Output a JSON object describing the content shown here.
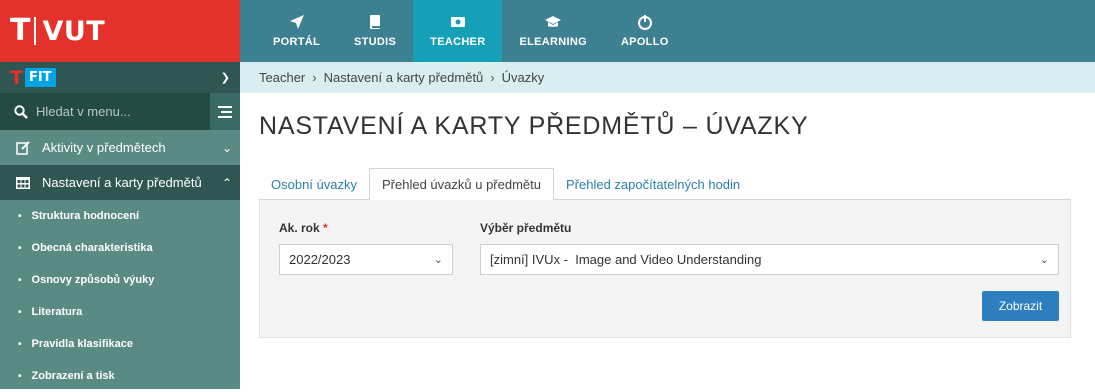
{
  "brand": {
    "logo_letter": "T",
    "logo_text": "VUT",
    "accent": "#e4312b",
    "nav_bg": "#3c8091",
    "nav_active": "#16a0b8"
  },
  "topnav": [
    {
      "label": "PORTÁL",
      "icon": "send-icon"
    },
    {
      "label": "STUDIS",
      "icon": "book-icon"
    },
    {
      "label": "TEACHER",
      "icon": "teacher-icon",
      "active": true
    },
    {
      "label": "ELEARNING",
      "icon": "graduation-cap-icon"
    },
    {
      "label": "APOLLO",
      "icon": "apollo-icon"
    }
  ],
  "sidebar": {
    "faculty_letter": "T",
    "faculty": "FIT",
    "search_placeholder": "Hledat v menu...",
    "items": [
      {
        "label": "Aktivity v předmětech",
        "icon": "edit-icon",
        "open": false
      },
      {
        "label": "Nastavení a karty předmětů",
        "icon": "table-icon",
        "open": true
      }
    ],
    "subitems": [
      "Struktura hodnocení",
      "Obecná charakteristika",
      "Osnovy způsobů výuky",
      "Literatura",
      "Pravidla klasifikace",
      "Zobrazení a tisk"
    ]
  },
  "breadcrumb": [
    "Teacher",
    "Nastavení a karty předmětů",
    "Úvazky"
  ],
  "page_title": "NASTAVENÍ A KARTY PŘEDMĚTŮ – ÚVAZKY",
  "tabs": [
    {
      "label": "Osobní úvazky",
      "active": false
    },
    {
      "label": "Přehled úvazků u předmětu",
      "active": true
    },
    {
      "label": "Přehled započítatelných hodin",
      "active": false
    }
  ],
  "form": {
    "year_label": "Ak. rok",
    "year_required": "*",
    "year_value": "2022/2023",
    "subject_label": "Výběr předmětu",
    "subject_value": "[zimní] IVUx -  Image and Video Understanding",
    "submit_label": "Zobrazit"
  }
}
